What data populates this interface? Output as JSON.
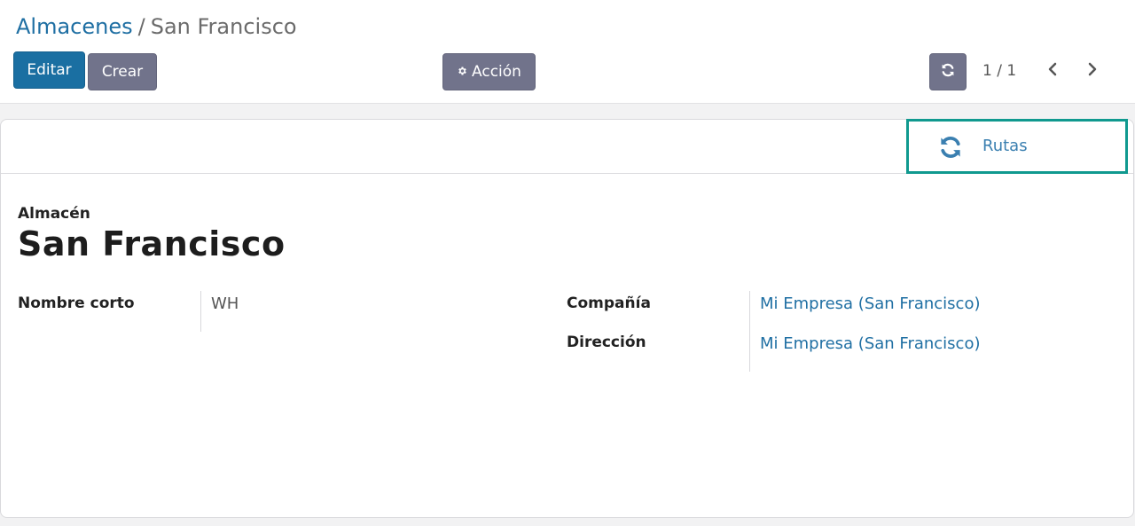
{
  "breadcrumb": {
    "parent": "Almacenes",
    "separator": "/",
    "current": "San Francisco"
  },
  "toolbar": {
    "edit_label": "Editar",
    "create_label": "Crear",
    "action_label": "Acción",
    "action_icon": "gear-icon",
    "refresh_icon": "refresh-icon"
  },
  "pager": {
    "value": "1 / 1",
    "prev_icon": "chevron-left-icon",
    "next_icon": "chevron-right-icon"
  },
  "smart_button": {
    "label": "Rutas",
    "icon": "refresh-icon"
  },
  "record": {
    "type_label": "Almacén",
    "name": "San Francisco"
  },
  "fields": {
    "short_name": {
      "label": "Nombre corto",
      "value": "WH"
    },
    "company": {
      "label": "Compañía",
      "value": "Mi Empresa (San Francisco)"
    },
    "address": {
      "label": "Dirección",
      "value": "Mi Empresa (San Francisco)"
    }
  },
  "colors": {
    "primary": "#1a6fa2",
    "secondary": "#71738b",
    "link": "#1f6fa3",
    "highlight_border": "#10998f"
  }
}
